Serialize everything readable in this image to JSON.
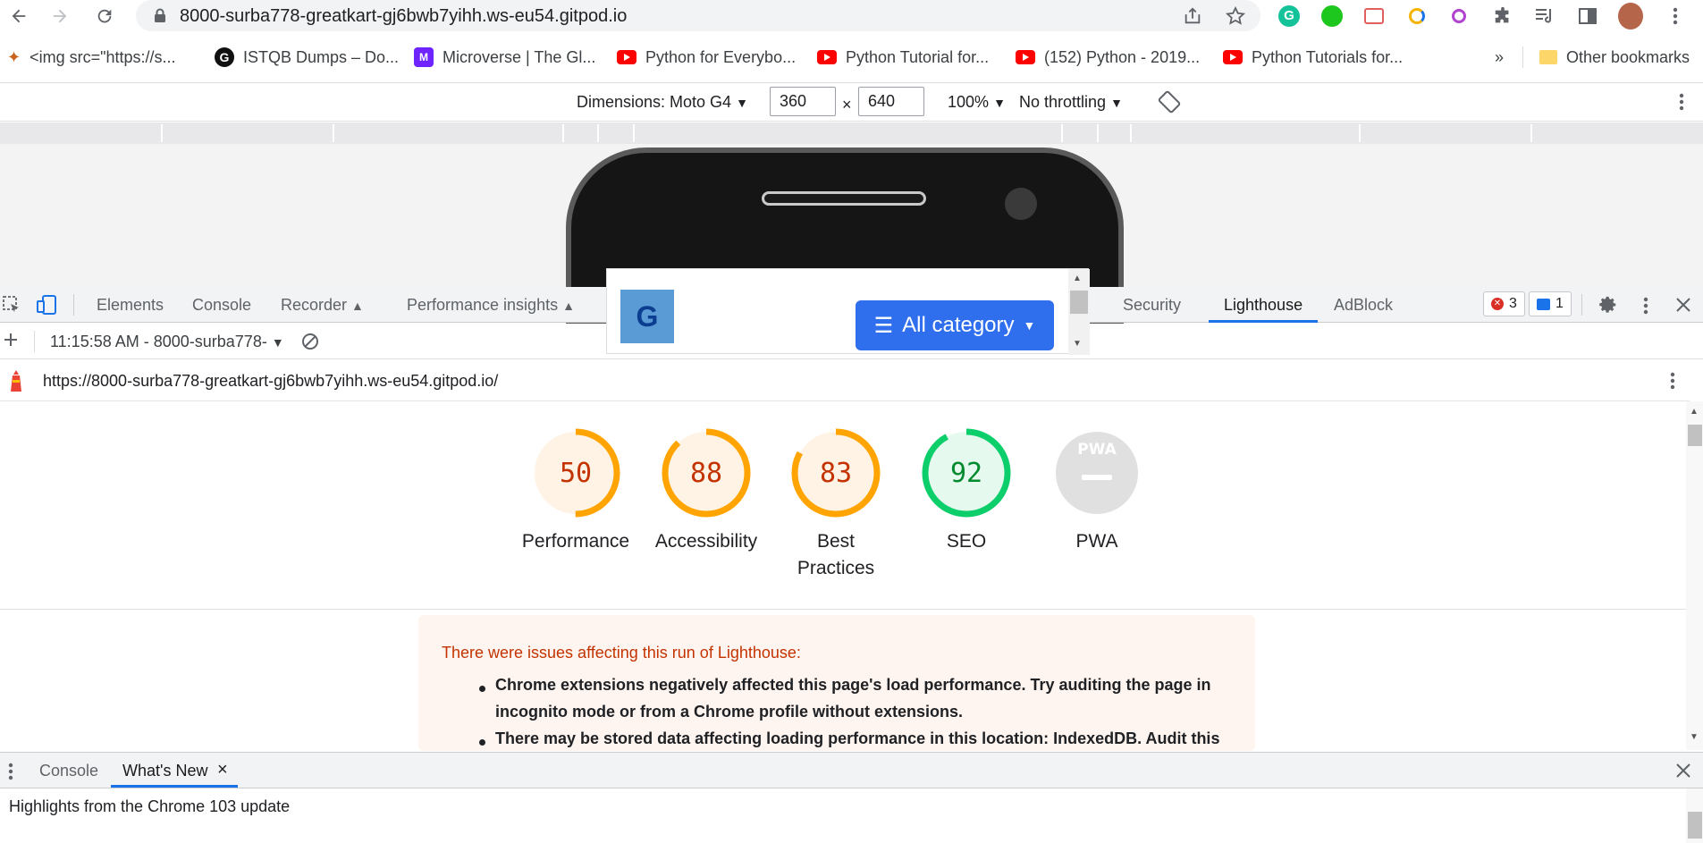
{
  "browser": {
    "url": "8000-surba778-greatkart-gj6bwb7yihh.ws-eu54.gitpod.io"
  },
  "bookmarks": [
    {
      "label": "<img src=\"https://s...",
      "icon": "bird-icon"
    },
    {
      "label": "ISTQB Dumps – Do...",
      "icon": "g-logo-icon"
    },
    {
      "label": "Microverse | The Gl...",
      "icon": "microverse-icon"
    },
    {
      "label": "Python for Everybo...",
      "icon": "youtube-icon"
    },
    {
      "label": "Python Tutorial for...",
      "icon": "youtube-icon"
    },
    {
      "label": "(152) Python - 2019...",
      "icon": "youtube-icon"
    },
    {
      "label": "Python Tutorials for...",
      "icon": "youtube-icon"
    }
  ],
  "bookmarks_more": "»",
  "other_bookmarks": "Other bookmarks",
  "device_toolbar": {
    "dimensions_label": "Dimensions: Moto G4",
    "width": "360",
    "times": "×",
    "height": "640",
    "zoom": "100%",
    "throttling": "No throttling"
  },
  "devtools": {
    "tabs": [
      "Elements",
      "Console",
      "Recorder",
      "Performance insights",
      "Security",
      "Lighthouse",
      "AdBlock"
    ],
    "active_tab": "Lighthouse",
    "errors_count": "3",
    "messages_count": "1",
    "report_selector": "11:15:58 AM - 8000-surba778-",
    "report_url": "https://8000-surba778-greatkart-gj6bwb7yihh.ws-eu54.gitpod.io/"
  },
  "page_preview": {
    "logo_letter": "G",
    "category_button": "All category"
  },
  "scores": [
    {
      "value": "50",
      "label": "Performance",
      "fraction": 0.5,
      "color": "#ffa400"
    },
    {
      "value": "88",
      "label": "Accessibility",
      "fraction": 0.88,
      "color": "#ffa400"
    },
    {
      "value": "83",
      "label": "Best Practices",
      "fraction": 0.83,
      "color": "#ffa400"
    },
    {
      "value": "92",
      "label": "SEO",
      "fraction": 0.92,
      "color": "#0cce6b"
    },
    {
      "value": "",
      "label": "PWA",
      "fraction": 0,
      "color": "#c4c4c4"
    }
  ],
  "pwa_badge": "PWA",
  "warning": {
    "title": "There were issues affecting this run of Lighthouse:",
    "items": [
      "Chrome extensions negatively affected this page's load performance. Try auditing the page in incognito mode or from a Chrome profile without extensions.",
      "There may be stored data affecting loading performance in this location: IndexedDB. Audit this"
    ]
  },
  "drawer": {
    "tabs": [
      "Console",
      "What's New"
    ],
    "active_tab": "What's New",
    "close": "×",
    "content": "Highlights from the Chrome 103 update"
  }
}
